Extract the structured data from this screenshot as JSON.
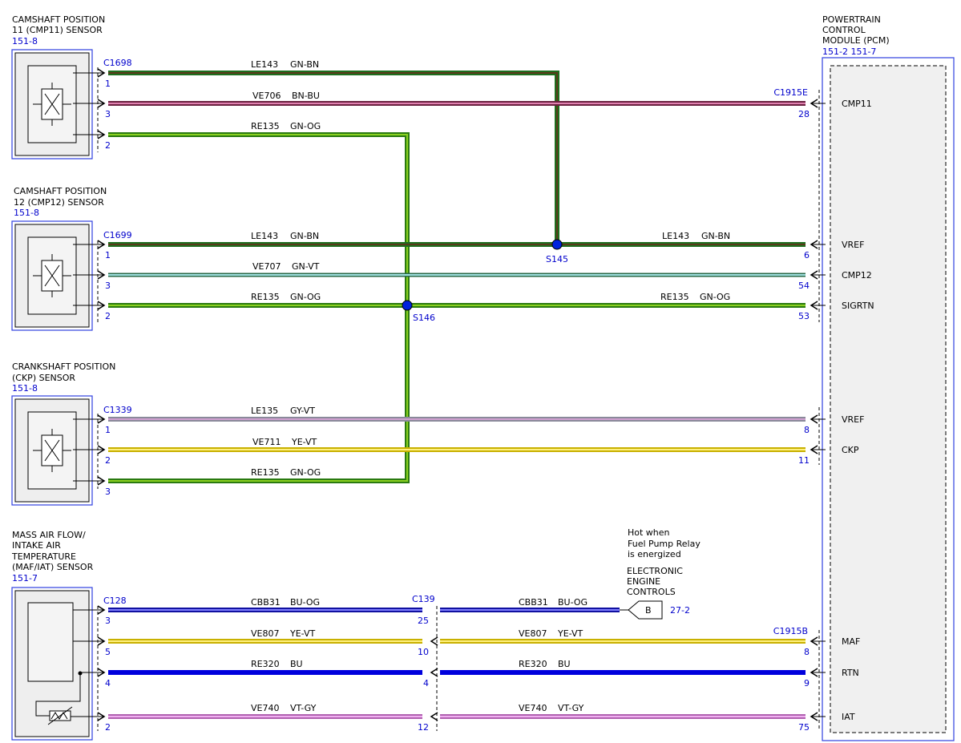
{
  "components": {
    "cmp11": {
      "name_lines": [
        "CAMSHAFT POSITION",
        "11 (CMP11) SENSOR"
      ],
      "ref": "151-8",
      "connector": "C1698"
    },
    "cmp12": {
      "name_lines": [
        "CAMSHAFT POSITION",
        "12 (CMP12) SENSOR"
      ],
      "ref": "151-8",
      "connector": "C1699"
    },
    "ckp": {
      "name_lines": [
        "CRANKSHAFT POSITION",
        "(CKP) SENSOR"
      ],
      "ref": "151-8",
      "connector": "C1339"
    },
    "maf": {
      "name_lines": [
        "MASS AIR FLOW/",
        "INTAKE AIR",
        "TEMPERATURE",
        "(MAF/IAT) SENSOR"
      ],
      "ref": "151-7",
      "connector": "C128"
    },
    "pcm": {
      "name_lines": [
        "POWERTRAIN",
        "CONTROL",
        "MODULE (PCM)"
      ],
      "ref": "151-2  151-7",
      "connector_top": "C1915E",
      "connector_bottom": "C1915B"
    }
  },
  "inline_connector": "C139",
  "splices": [
    "S145",
    "S146"
  ],
  "note": {
    "lines": [
      "Hot when",
      "Fuel Pump Relay",
      "is energized"
    ]
  },
  "eec": {
    "lines": [
      "ELECTRONIC",
      "ENGINE",
      "CONTROLS"
    ],
    "tag": "B",
    "ref": "27-2"
  },
  "wires": [
    {
      "circuit": "LE143",
      "color": "GN-BN"
    },
    {
      "circuit": "VE706",
      "color": "BN-BU"
    },
    {
      "circuit": "RE135",
      "color": "GN-OG"
    },
    {
      "circuit": "LE143",
      "color": "GN-BN"
    },
    {
      "circuit": "VE707",
      "color": "GN-VT"
    },
    {
      "circuit": "RE135",
      "color": "GN-OG"
    },
    {
      "circuit": "LE135",
      "color": "GY-VT"
    },
    {
      "circuit": "VE711",
      "color": "YE-VT"
    },
    {
      "circuit": "RE135",
      "color": "GN-OG"
    },
    {
      "circuit": "CBB31",
      "color": "BU-OG"
    },
    {
      "circuit": "VE807",
      "color": "YE-VT"
    },
    {
      "circuit": "RE320",
      "color": "BU"
    },
    {
      "circuit": "VE740",
      "color": "VT-GY"
    }
  ],
  "pins": {
    "cmp11": [
      "1",
      "3",
      "2"
    ],
    "cmp12": [
      "1",
      "3",
      "2"
    ],
    "ckp": [
      "1",
      "2",
      "3"
    ],
    "maf": [
      "3",
      "5",
      "4",
      "2"
    ],
    "c139": [
      "25",
      "10",
      "4",
      "12"
    ],
    "pcm": [
      "28",
      "6",
      "54",
      "53",
      "8",
      "11",
      "8",
      "9",
      "75"
    ]
  },
  "pcm_signals": [
    "CMP11",
    "VREF",
    "CMP12",
    "SIGRTN",
    "VREF",
    "CKP",
    "MAF",
    "RTN",
    "IAT"
  ],
  "wire_colors": {
    "GN-BN": [
      "#1e6e1e",
      "#5a3a1a"
    ],
    "BN-BU": [
      "#6b2040",
      "#e080b0"
    ],
    "GN-OG": [
      "#2a7a10",
      "#8ad020"
    ],
    "GN-VT": [
      "#2a6a4a",
      "#a0e0e0"
    ],
    "GY-VT": [
      "#8a8a9a",
      "#d0a0d0"
    ],
    "YE-VT": [
      "#c8b000",
      "#fff080"
    ],
    "BU-OG": [
      "#1010a0",
      "#8080ff"
    ],
    "BU": [
      "#0000dd",
      "#0000dd"
    ],
    "VT-GY": [
      "#b060b0",
      "#f0b0f0"
    ]
  }
}
